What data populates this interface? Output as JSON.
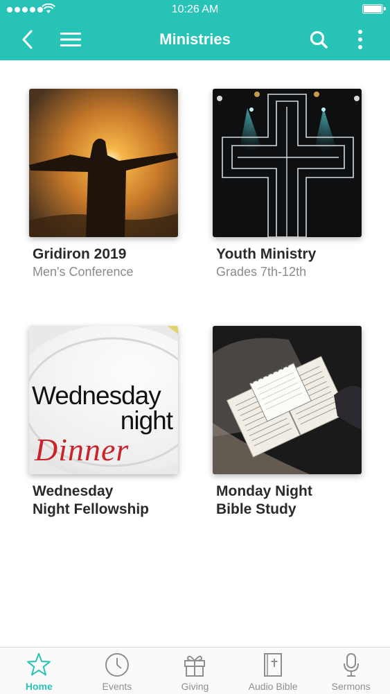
{
  "status_bar": {
    "time": "10:26 AM"
  },
  "header": {
    "title": "Ministries",
    "bg_color": "#27c3b6",
    "icons": [
      "chevron-left-icon",
      "hamburger-menu-icon",
      "search-icon",
      "more-vertical-icon"
    ]
  },
  "ministries": [
    {
      "title": "Gridiron 2019",
      "subtitle": "Men's Conference",
      "image": "man-at-sunrise"
    },
    {
      "title": "Youth Ministry",
      "subtitle": "Grades 7th-12th",
      "image": "neon-cross-on-stage"
    },
    {
      "title_line1": "Wednesday",
      "title_line2": "Night Fellowship",
      "image": "wednesday-night-dinner-plate",
      "image_text": {
        "line1": "Wednesday",
        "line2": "night",
        "line3": "Dinner"
      }
    },
    {
      "title_line1": "Monday Night",
      "title_line2": "Bible Study",
      "image": "open-bible-with-notebook"
    }
  ],
  "tabs": [
    {
      "label": "Home",
      "icon": "star-icon",
      "active": true
    },
    {
      "label": "Events",
      "icon": "clock-icon",
      "active": false
    },
    {
      "label": "Giving",
      "icon": "gift-icon",
      "active": false
    },
    {
      "label": "Audio Bible",
      "icon": "bible-icon",
      "active": false
    },
    {
      "label": "Sermons",
      "icon": "microphone-icon",
      "active": false
    }
  ],
  "colors": {
    "accent": "#27c3b6",
    "title_text": "#2a2a2a",
    "subtitle_text": "#8b8b8b",
    "tab_inactive": "#8e8e8e"
  }
}
